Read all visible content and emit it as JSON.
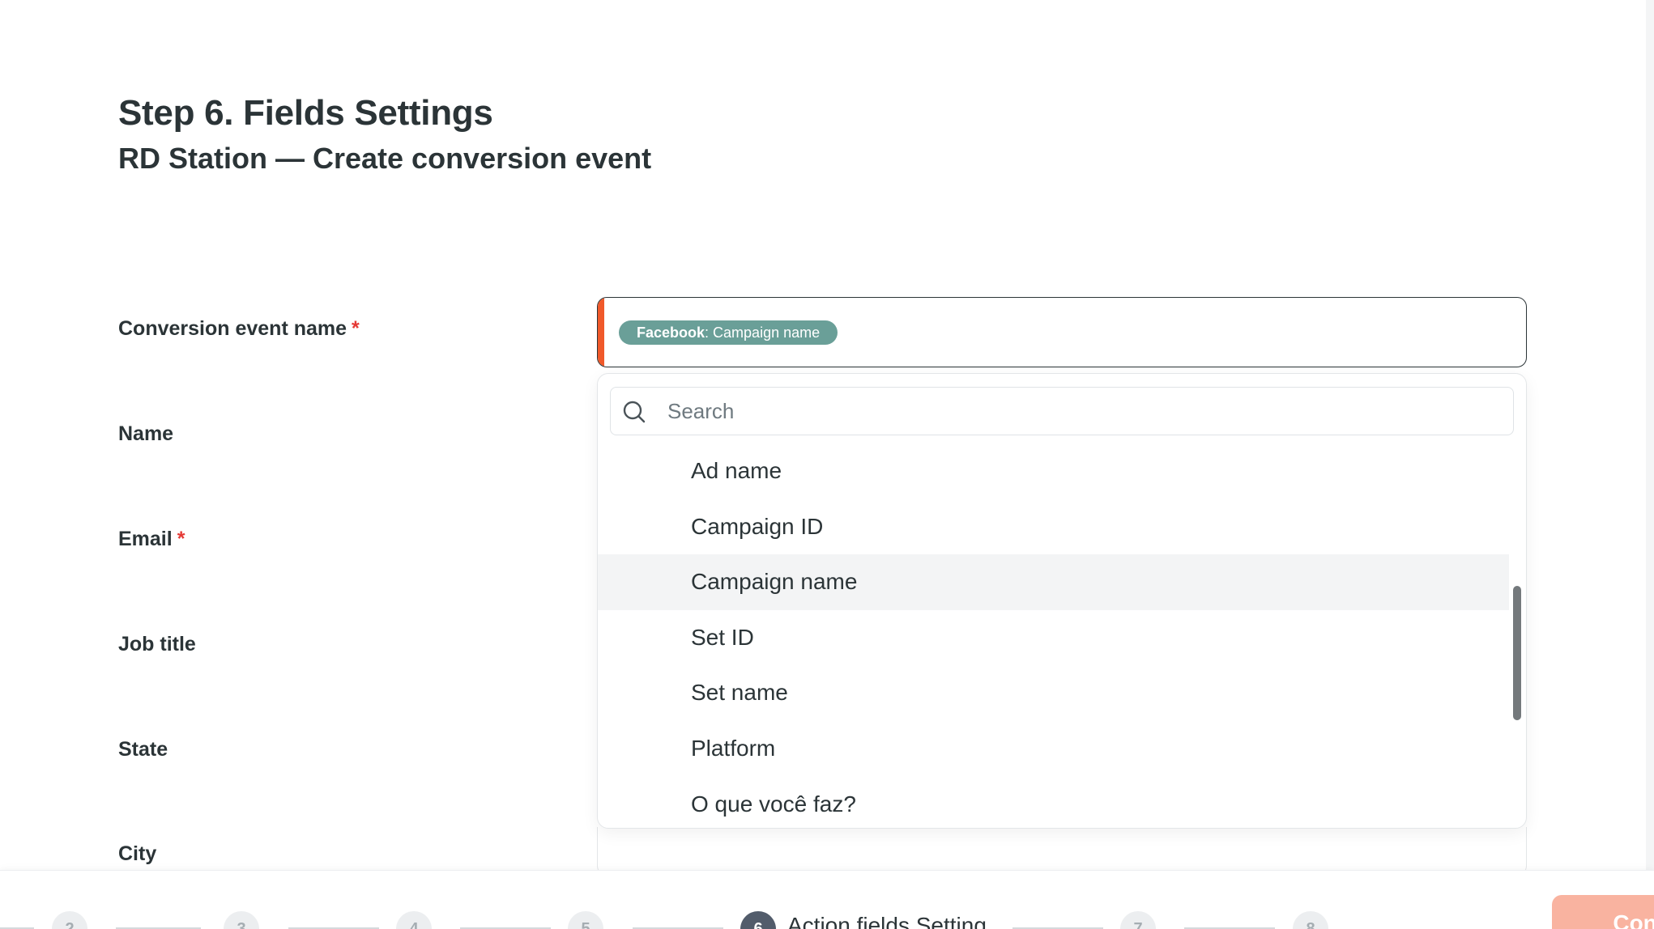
{
  "header": {
    "title": "Step 6. Fields Settings",
    "subtitle": "RD Station — Create conversion event"
  },
  "fields": [
    {
      "label": "Conversion event name",
      "required": "*"
    },
    {
      "label": "Name"
    },
    {
      "label": "Email",
      "required": "*"
    },
    {
      "label": "Job title"
    },
    {
      "label": "State"
    },
    {
      "label": "City"
    }
  ],
  "selected_value": {
    "source": "Facebook",
    "separator": ": ",
    "field": "Campaign name"
  },
  "dropdown": {
    "search_placeholder": "Search",
    "options": [
      "Ad name",
      "Campaign ID",
      "Campaign name",
      "Set ID",
      "Set name",
      "Platform",
      "O que você faz?"
    ],
    "selected_option": "Campaign name"
  },
  "stepper": {
    "steps": [
      "2",
      "3",
      "4",
      "5",
      "6",
      "7",
      "8"
    ],
    "active_step": "6",
    "active_label": "Action fields Setting"
  },
  "footer": {
    "continue_label": "Continue"
  },
  "colors": {
    "accent": "#f0592a",
    "chip": "#6a9f98",
    "required": "#e53935",
    "active_step": "#525c6b",
    "continue_button": "#f9b3a0"
  }
}
